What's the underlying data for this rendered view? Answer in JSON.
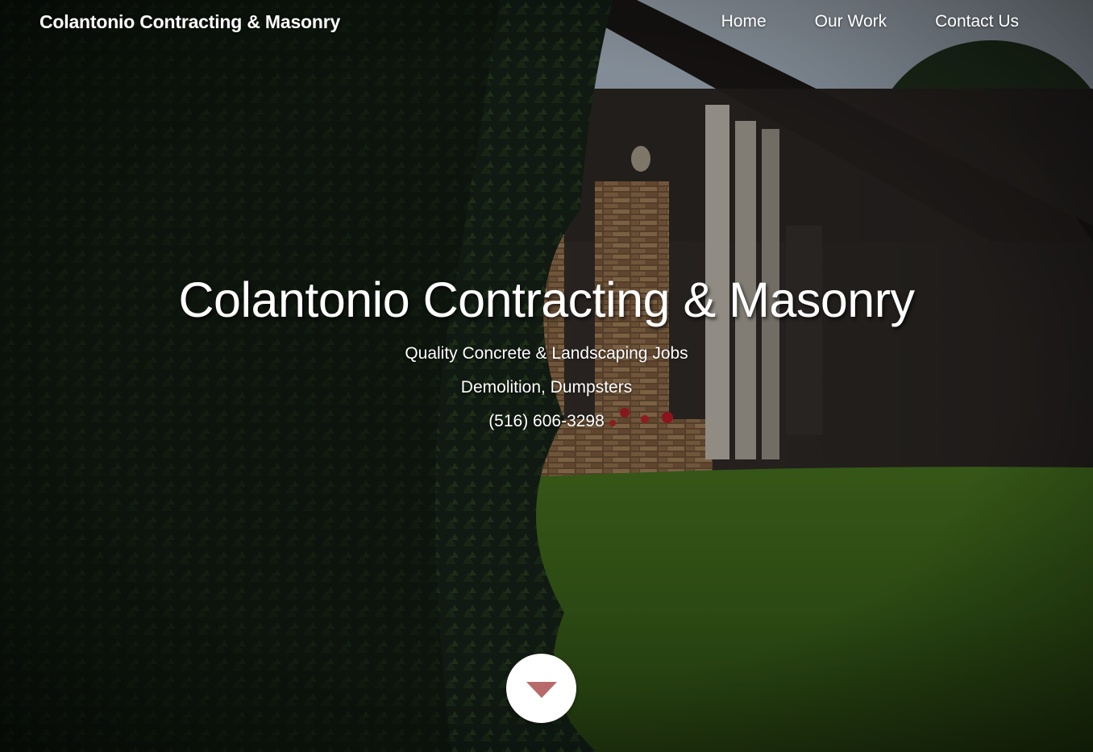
{
  "header": {
    "brand": "Colantonio Contracting & Masonry",
    "nav": [
      {
        "label": "Home"
      },
      {
        "label": "Our Work"
      },
      {
        "label": "Contact Us"
      }
    ]
  },
  "hero": {
    "title": "Colantonio Contracting & Masonry",
    "tagline": "Quality Concrete & Landscaping Jobs",
    "services": "Demolition, Dumpsters",
    "phone": "(516) 606-3298",
    "scroll_icon": "caret-down-icon"
  },
  "colors": {
    "text": "#ffffff",
    "scroll_button_bg": "#ffffff",
    "scroll_arrow": "#b86a6a",
    "lawn": "#4f7a2a",
    "evergreen": "#1c2b17"
  }
}
